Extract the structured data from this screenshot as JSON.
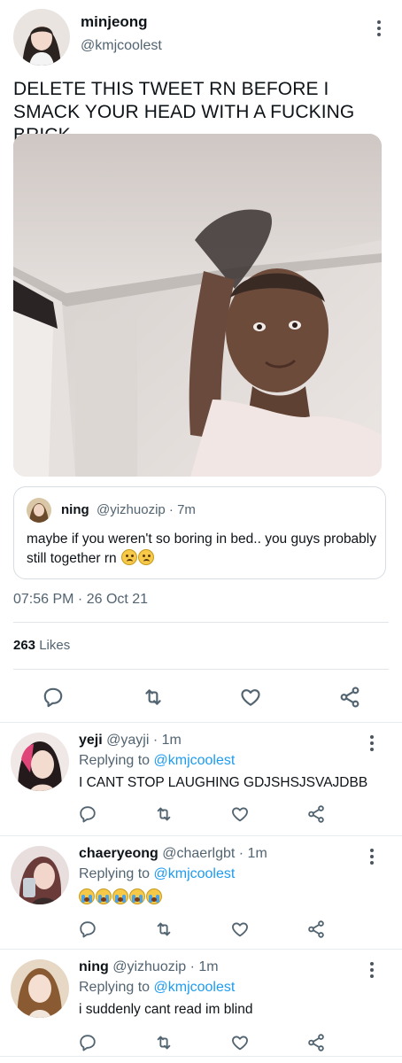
{
  "tweet": {
    "display_name": "minjeong",
    "handle": "@kmjcoolest",
    "text": "DELETE THIS TWEET RN BEFORE I SMACK YOUR HEAD WITH A FUCKING BRICK",
    "timestamp": "07:56 PM · 26 Oct 21",
    "likes_count": "263",
    "likes_label": "Likes"
  },
  "quote": {
    "display_name": "ning",
    "meta": "@yizhuozip · 7m",
    "text": "maybe if you weren't so boring in bed.. you guys probably still together rn",
    "emojis": [
      "frowning-face",
      "frowning-face"
    ]
  },
  "replies": [
    {
      "display_name": "yeji",
      "meta": "@yayji · 1m",
      "replying_prefix": "Replying to",
      "replying_to": "@kmjcoolest",
      "text": "I CANT STOP LAUGHING GDJSHSJSVAJDBB"
    },
    {
      "display_name": "chaeryeong",
      "meta": "@chaerlgbt · 1m",
      "replying_prefix": "Replying to",
      "replying_to": "@kmjcoolest",
      "text": "",
      "emojis": [
        "loudly-crying-face",
        "loudly-crying-face",
        "loudly-crying-face",
        "loudly-crying-face",
        "loudly-crying-face"
      ]
    },
    {
      "display_name": "ning",
      "meta": "@yizhuozip · 1m",
      "replying_prefix": "Replying to",
      "replying_to": "@kmjcoolest",
      "text": "i suddenly cant read im blind"
    }
  ],
  "icons": {
    "reply": "reply-icon",
    "retweet": "retweet-icon",
    "like": "heart-icon",
    "share": "share-icon",
    "more": "more-vertical-icon"
  },
  "colors": {
    "link": "#1d9bf0",
    "secondary_text": "#536471",
    "divider": "#e1e6ea"
  }
}
